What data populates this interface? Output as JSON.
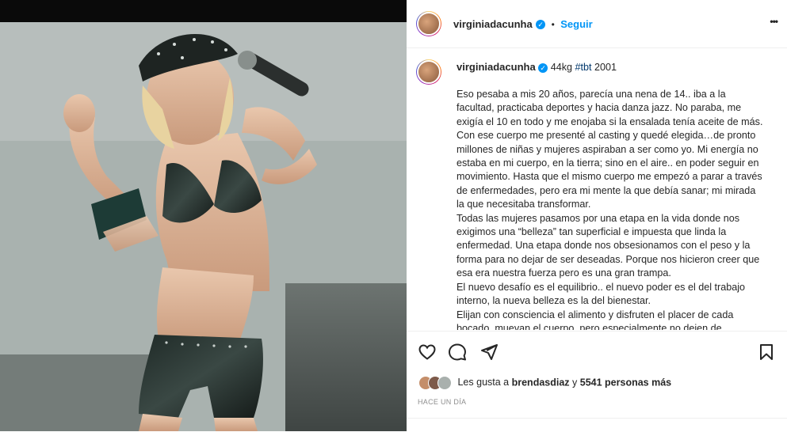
{
  "post": {
    "username": "virginiadacunha",
    "follow_label": "Seguir",
    "separator": "•",
    "more_label": "•••",
    "caption_head": "44kg",
    "caption_tag": "#tbt",
    "caption_year": "2001",
    "caption_paragraphs": [
      "Eso pesaba a mis 20 años, parecía una nena de 14.. iba a la facultad, practicaba deportes y hacia danza jazz. No paraba, me exigía el 10 en todo y me enojaba si la ensalada tenía aceite de más. Con ese cuerpo me presenté al casting y quedé elegida…de pronto millones de niñas y mujeres aspiraban a ser como yo. Mi energía no estaba en mi cuerpo, en la tierra; sino en el aire.. en poder seguir en movimiento. Hasta que el mismo cuerpo me empezó a parar a través de enfermedades, pero era mi mente la que debía sanar; mi mirada la que necesitaba transformar.",
      "Todas las mujeres pasamos por una etapa en la vida donde nos exigimos una “belleza” tan superficial e impuesta que linda la enfermedad. Una etapa donde nos obsesionamos con el peso y la forma para no dejar de ser deseadas. Porque nos hicieron creer que esa era nuestra fuerza pero es una gran trampa.",
      "El nuevo desafío es el equilibrio.. el nuevo poder es el del trabajo interno, la nueva belleza es la del bienestar.",
      "Elijan con consciencia el alimento y disfruten el placer de cada bocado, muevan el cuerpo, pero especialmente no dejen de"
    ],
    "likes_prefix": "Les gusta a",
    "likes_user": "brendasdiaz",
    "likes_joiner": "y",
    "likes_others": "5541 personas más",
    "timestamp": "HACE UN DÍA"
  },
  "icons": {
    "like": "heart-icon",
    "comment": "comment-icon",
    "share": "send-icon",
    "save": "bookmark-icon",
    "verified": "verified-badge-icon",
    "more": "more-options-icon"
  },
  "colors": {
    "link": "#0095f6",
    "text": "#262626",
    "muted": "#8e8e8e",
    "verified": "#0095f6"
  }
}
